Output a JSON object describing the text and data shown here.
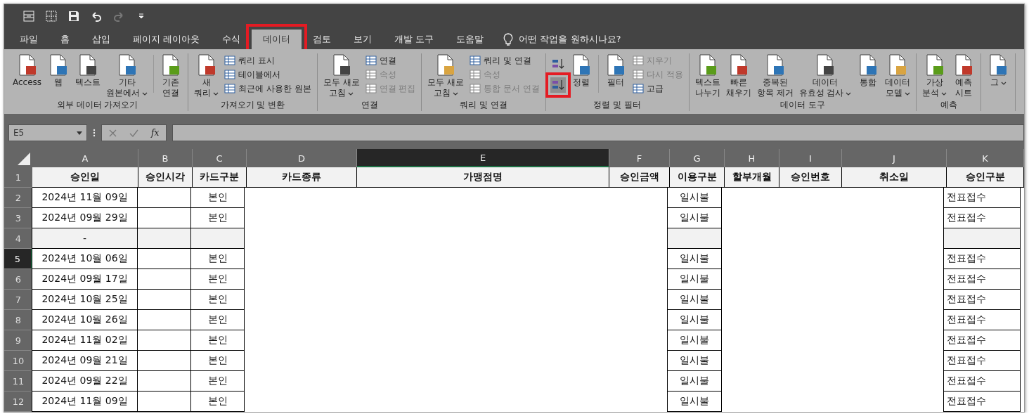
{
  "tabs": [
    {
      "label": "파일",
      "selected": false,
      "highlighted": false
    },
    {
      "label": "홈",
      "selected": false,
      "highlighted": false
    },
    {
      "label": "삽입",
      "selected": false,
      "highlighted": false
    },
    {
      "label": "페이지 레이아웃",
      "selected": false,
      "highlighted": false
    },
    {
      "label": "수식",
      "selected": false,
      "highlighted": false
    },
    {
      "label": "데이터",
      "selected": true,
      "highlighted": true
    },
    {
      "label": "검토",
      "selected": false,
      "highlighted": false
    },
    {
      "label": "보기",
      "selected": false,
      "highlighted": false
    },
    {
      "label": "개발 도구",
      "selected": false,
      "highlighted": false
    },
    {
      "label": "도움말",
      "selected": false,
      "highlighted": false
    }
  ],
  "tell_me": {
    "placeholder": "어떤 작업을 원하시나요?"
  },
  "ribbon_groups": [
    {
      "label": "외부 데이터 가져오기",
      "items": [
        {
          "kind": "large",
          "lines": [
            "Access"
          ],
          "dropdown": false
        },
        {
          "kind": "large",
          "lines": [
            "웹"
          ],
          "dropdown": false
        },
        {
          "kind": "large",
          "lines": [
            "텍스트"
          ],
          "dropdown": false
        },
        {
          "kind": "large",
          "lines": [
            "기타",
            "원본에서"
          ],
          "dropdown": true
        },
        {
          "kind": "separator"
        },
        {
          "kind": "large",
          "lines": [
            "기존",
            "연결"
          ],
          "dropdown": false
        }
      ]
    },
    {
      "label": "가져오기 및 변환",
      "items": [
        {
          "kind": "large",
          "lines": [
            "새",
            "쿼리"
          ],
          "dropdown": true
        },
        {
          "kind": "stack",
          "entries": [
            {
              "label": "쿼리 표시",
              "disabled": false
            },
            {
              "label": "테이블에서",
              "disabled": false
            },
            {
              "label": "최근에 사용한 원본",
              "disabled": false
            }
          ]
        }
      ]
    },
    {
      "label": "연결",
      "items": [
        {
          "kind": "large",
          "lines": [
            "모두 새로",
            "고침"
          ],
          "dropdown": true
        },
        {
          "kind": "stack",
          "entries": [
            {
              "label": "연결",
              "disabled": false
            },
            {
              "label": "속성",
              "disabled": true
            },
            {
              "label": "연결 편집",
              "disabled": true
            }
          ]
        }
      ]
    },
    {
      "label": "쿼리 및 연결",
      "items": [
        {
          "kind": "large",
          "lines": [
            "모두 새로",
            "고침"
          ],
          "dropdown": true
        },
        {
          "kind": "stack",
          "entries": [
            {
              "label": "쿼리 및 연결",
              "disabled": false
            },
            {
              "label": "속성",
              "disabled": true
            },
            {
              "label": "통합 문서 연결",
              "disabled": true
            }
          ]
        }
      ]
    },
    {
      "label": "정렬 및 필터",
      "items": [
        {
          "kind": "sort_pair",
          "buttons": [
            {
              "highlighted": false
            },
            {
              "highlighted": true
            }
          ]
        },
        {
          "kind": "large",
          "lines": [
            "정렬"
          ],
          "dropdown": false
        },
        {
          "kind": "separator"
        },
        {
          "kind": "large",
          "lines": [
            "필터"
          ],
          "dropdown": false
        },
        {
          "kind": "stack",
          "entries": [
            {
              "label": "지우기",
              "disabled": true
            },
            {
              "label": "다시 적용",
              "disabled": true
            },
            {
              "label": "고급",
              "disabled": false
            }
          ]
        }
      ]
    },
    {
      "label": "데이터 도구",
      "items": [
        {
          "kind": "large",
          "lines": [
            "텍스트",
            "나누기"
          ],
          "dropdown": false
        },
        {
          "kind": "large",
          "lines": [
            "빠른",
            "채우기"
          ],
          "dropdown": false
        },
        {
          "kind": "large",
          "lines": [
            "중복된",
            "항목 제거"
          ],
          "dropdown": false
        },
        {
          "kind": "large",
          "lines": [
            "데이터",
            "유효성 검사"
          ],
          "dropdown": true
        },
        {
          "kind": "large",
          "lines": [
            "통합"
          ],
          "dropdown": false
        },
        {
          "kind": "large",
          "lines": [
            "데이터",
            "모델"
          ],
          "dropdown": true
        }
      ]
    },
    {
      "label": "예측",
      "items": [
        {
          "kind": "large",
          "lines": [
            "가상",
            "분석"
          ],
          "dropdown": true
        },
        {
          "kind": "large",
          "lines": [
            "예측",
            "시트"
          ],
          "dropdown": false
        }
      ]
    },
    {
      "items": [
        {
          "kind": "large",
          "lines": [
            "그"
          ],
          "dropdown": true
        }
      ]
    }
  ],
  "formula_bar": {
    "name_box": "E5",
    "function_label": "fx"
  },
  "columns": [
    {
      "letter": "A",
      "title": "승인일",
      "bordered": true,
      "selected": false
    },
    {
      "letter": "B",
      "title": "승인시각",
      "bordered": true,
      "selected": false
    },
    {
      "letter": "C",
      "title": "카드구분",
      "bordered": true,
      "selected": false
    },
    {
      "letter": "D",
      "title": "카드종류",
      "bordered": false,
      "selected": false
    },
    {
      "letter": "E",
      "title": "가맹점명",
      "bordered": false,
      "selected": true
    },
    {
      "letter": "F",
      "title": "승인금액",
      "bordered": false,
      "selected": false
    },
    {
      "letter": "G",
      "title": "이용구분",
      "bordered": true,
      "selected": false
    },
    {
      "letter": "H",
      "title": "할부개월",
      "bordered": false,
      "selected": false
    },
    {
      "letter": "I",
      "title": "승인번호",
      "bordered": false,
      "selected": false
    },
    {
      "letter": "J",
      "title": "취소일",
      "bordered": false,
      "selected": false
    },
    {
      "letter": "K",
      "title": "승인구분",
      "bordered": true,
      "selected": false
    }
  ],
  "header_row": {
    "number": "1",
    "selected": false
  },
  "rows": [
    {
      "number": "2",
      "selected": false,
      "shaded": false,
      "cells": {
        "A": "2024년 11월 09일",
        "C": "본인",
        "G": "일시불",
        "K": "전표접수"
      }
    },
    {
      "number": "3",
      "selected": false,
      "shaded": false,
      "cells": {
        "A": "2024년 09월 29일",
        "C": "본인",
        "G": "일시불",
        "K": "전표접수"
      }
    },
    {
      "number": "4",
      "selected": false,
      "shaded": true,
      "cells": {
        "A": "-"
      }
    },
    {
      "number": "5",
      "selected": true,
      "shaded": false,
      "cells": {
        "A": "2024년 10월 06일",
        "C": "본인",
        "G": "일시불",
        "K": "전표접수"
      }
    },
    {
      "number": "6",
      "selected": false,
      "shaded": false,
      "cells": {
        "A": "2024년 09월 17일",
        "C": "본인",
        "G": "일시불",
        "K": "전표접수"
      }
    },
    {
      "number": "7",
      "selected": false,
      "shaded": false,
      "cells": {
        "A": "2024년 10월 25일",
        "C": "본인",
        "G": "일시불",
        "K": "전표접수"
      }
    },
    {
      "number": "8",
      "selected": false,
      "shaded": false,
      "cells": {
        "A": "2024년 10월 26일",
        "C": "본인",
        "G": "일시불",
        "K": "전표접수"
      }
    },
    {
      "number": "9",
      "selected": false,
      "shaded": false,
      "cells": {
        "A": "2024년 11월 02일",
        "C": "본인",
        "G": "일시불",
        "K": "전표접수"
      }
    },
    {
      "number": "10",
      "selected": false,
      "shaded": false,
      "cells": {
        "A": "2024년 09월 21일",
        "C": "본인",
        "G": "일시불",
        "K": "전표접수"
      }
    },
    {
      "number": "11",
      "selected": false,
      "shaded": false,
      "cells": {
        "A": "2024년 09월 22일",
        "C": "본인",
        "G": "일시불",
        "K": "전표접수"
      }
    },
    {
      "number": "12",
      "selected": false,
      "shaded": false,
      "cells": {
        "A": "2024년 11월 09일",
        "C": "본인",
        "G": "일시불",
        "K": "전표접수"
      }
    }
  ]
}
